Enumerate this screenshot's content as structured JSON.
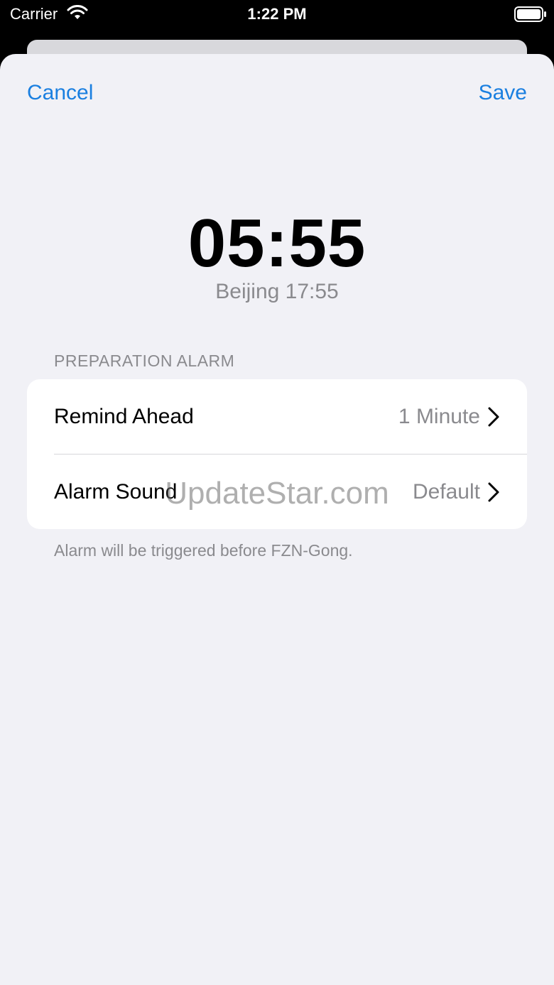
{
  "status_bar": {
    "carrier": "Carrier",
    "time": "1:22 PM",
    "icons": [
      "wifi-icon",
      "battery-icon"
    ]
  },
  "nav": {
    "cancel_label": "Cancel",
    "save_label": "Save",
    "accent_color": "#1a7fe0"
  },
  "alarm": {
    "time": "05:55",
    "subtitle": "Beijing 17:55"
  },
  "section": {
    "header": "PREPARATION ALARM",
    "rows": [
      {
        "label": "Remind Ahead",
        "value": "1 Minute",
        "icon": "chevron-right-icon"
      },
      {
        "label": "Alarm Sound",
        "value": "Default",
        "icon": "chevron-right-icon"
      }
    ],
    "footer": "Alarm will be triggered before FZN-Gong."
  },
  "watermark": "UpdateStar.com"
}
